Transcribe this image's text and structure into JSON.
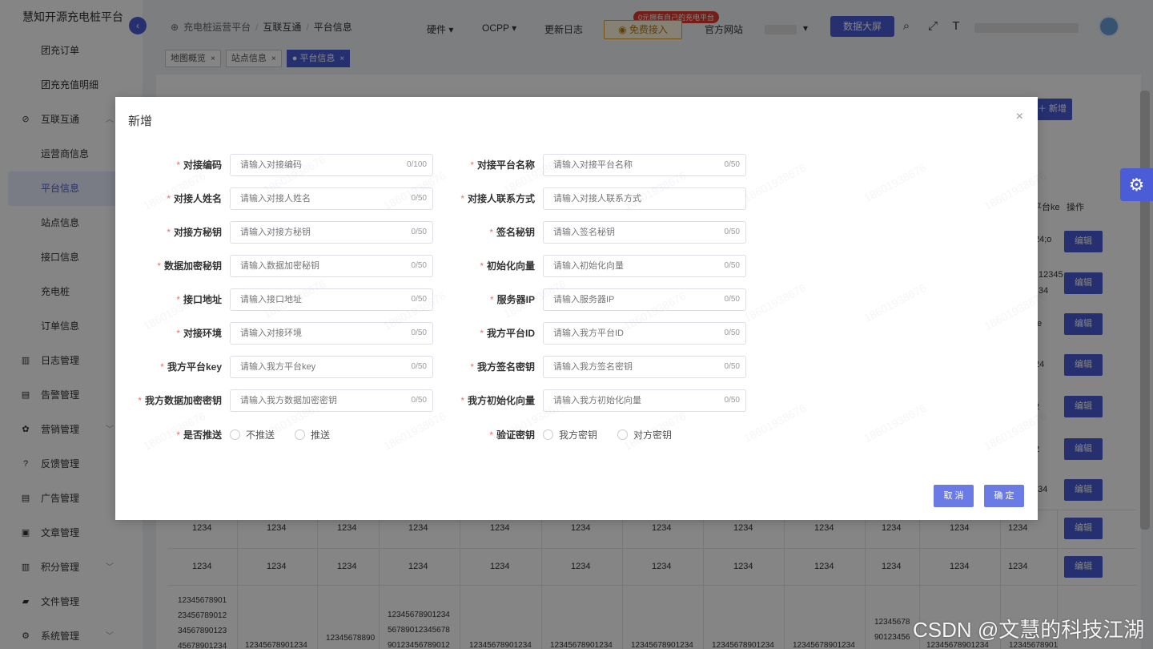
{
  "app": {
    "title": "慧知开源充电桩平台",
    "collapse_icon": "chevron-left-icon"
  },
  "sidebar": {
    "items": [
      {
        "label": "团充订单",
        "type": "sub"
      },
      {
        "label": "团充充值明细",
        "type": "sub"
      },
      {
        "label": "互联互通",
        "type": "group",
        "icon": "link-icon",
        "glyph": "⊘",
        "expanded": true
      },
      {
        "label": "运营商信息",
        "type": "sub"
      },
      {
        "label": "平台信息",
        "type": "sub",
        "active": true
      },
      {
        "label": "站点信息",
        "type": "sub"
      },
      {
        "label": "接口信息",
        "type": "sub"
      },
      {
        "label": "充电桩",
        "type": "sub"
      },
      {
        "label": "订单信息",
        "type": "sub"
      },
      {
        "label": "日志管理",
        "type": "group",
        "icon": "log-icon",
        "glyph": "▥"
      },
      {
        "label": "告警管理",
        "type": "group",
        "icon": "alarm-icon",
        "glyph": "▤"
      },
      {
        "label": "营销管理",
        "type": "group",
        "icon": "marketing-icon",
        "glyph": "✿",
        "expandable": true
      },
      {
        "label": "反馈管理",
        "type": "group",
        "icon": "feedback-icon",
        "glyph": "?"
      },
      {
        "label": "广告管理",
        "type": "group",
        "icon": "ad-icon",
        "glyph": "▤"
      },
      {
        "label": "文章管理",
        "type": "group",
        "icon": "article-icon",
        "glyph": "▣"
      },
      {
        "label": "积分管理",
        "type": "group",
        "icon": "points-icon",
        "glyph": "▥",
        "expandable": true
      },
      {
        "label": "文件管理",
        "type": "group",
        "icon": "folder-icon",
        "glyph": "▰"
      },
      {
        "label": "系统管理",
        "type": "group",
        "icon": "settings-icon",
        "glyph": "⚙",
        "expandable": true
      }
    ]
  },
  "header": {
    "breadcrumb": [
      "充电桩运营平台",
      "互联互通",
      "平台信息"
    ],
    "nav": [
      "硬件",
      "OCPP",
      "更新日志"
    ],
    "free_button": "免费接入",
    "free_badge": "0元拥有自己的充电平台",
    "official_site": "官方网站",
    "bigscreen": "数据大屏"
  },
  "tags": [
    {
      "label": "地图概览",
      "active": false
    },
    {
      "label": "站点信息",
      "active": false
    },
    {
      "label": "平台信息",
      "active": true
    }
  ],
  "table": {
    "new_button": "新增",
    "platform_key_header": "平台ke",
    "op_header": "操作",
    "edit_label": "编辑",
    "row_cell": "1234",
    "partial_values": [
      "24;o",
      "12345",
      "34",
      "te",
      "24",
      "2",
      "2",
      "234"
    ],
    "long_col1": [
      "12345678901",
      "23456789012",
      "34567890123",
      "45678901234"
    ],
    "long_col4": [
      "12345678901234",
      "56789012345678",
      "90123456789012"
    ],
    "long_col3": "12345678890",
    "long_col10": [
      "12345678",
      "90123456"
    ],
    "long_bottom": "12345678901234",
    "long_bottom_last": "12345678901"
  },
  "dialog": {
    "title": "新增",
    "close_icon": "close-icon",
    "left_fields": [
      {
        "label": "对接编码",
        "placeholder": "请输入对接编码",
        "count": "0/100"
      },
      {
        "label": "对接人姓名",
        "placeholder": "请输入对接人姓名",
        "count": "0/50"
      },
      {
        "label": "对接方秘钥",
        "placeholder": "请输入对接方秘钥",
        "count": "0/50"
      },
      {
        "label": "数据加密秘钥",
        "placeholder": "请输入数据加密秘钥",
        "count": "0/50"
      },
      {
        "label": "接口地址",
        "placeholder": "请输入接口地址",
        "count": "0/50"
      },
      {
        "label": "对接环境",
        "placeholder": "请输入对接环境",
        "count": "0/50"
      },
      {
        "label": "我方平台key",
        "placeholder": "请输入我方平台key",
        "count": "0/50"
      },
      {
        "label": "我方数据加密密钥",
        "placeholder": "请输入我方数据加密密钥",
        "count": "0/50"
      }
    ],
    "right_fields": [
      {
        "label": "对接平台名称",
        "placeholder": "请输入对接平台名称",
        "count": "0/50"
      },
      {
        "label": "对接人联系方式",
        "placeholder": "请输入对接人联系方式",
        "count": ""
      },
      {
        "label": "签名秘钥",
        "placeholder": "请输入签名秘钥",
        "count": "0/50"
      },
      {
        "label": "初始化向量",
        "placeholder": "请输入初始化向量",
        "count": "0/50"
      },
      {
        "label": "服务器IP",
        "placeholder": "请输入服务器IP",
        "count": "0/50"
      },
      {
        "label": "我方平台ID",
        "placeholder": "请输入我方平台ID",
        "count": "0/50"
      },
      {
        "label": "我方签名密钥",
        "placeholder": "请输入我方签名密钥",
        "count": "0/50"
      },
      {
        "label": "我方初始化向量",
        "placeholder": "请输入我方初始化向量",
        "count": "0/50"
      }
    ],
    "push": {
      "label": "是否推送",
      "options": [
        "不推送",
        "推送"
      ]
    },
    "verify": {
      "label": "验证密钥",
      "options": [
        "我方密钥",
        "对方密钥"
      ]
    },
    "cancel": "取 消",
    "confirm": "确 定",
    "watermark": "18601938676"
  },
  "footer_watermark": "CSDN @文慧的科技江湖",
  "colors": {
    "accent": "#4a5cd6",
    "required": "#f56c6c"
  }
}
